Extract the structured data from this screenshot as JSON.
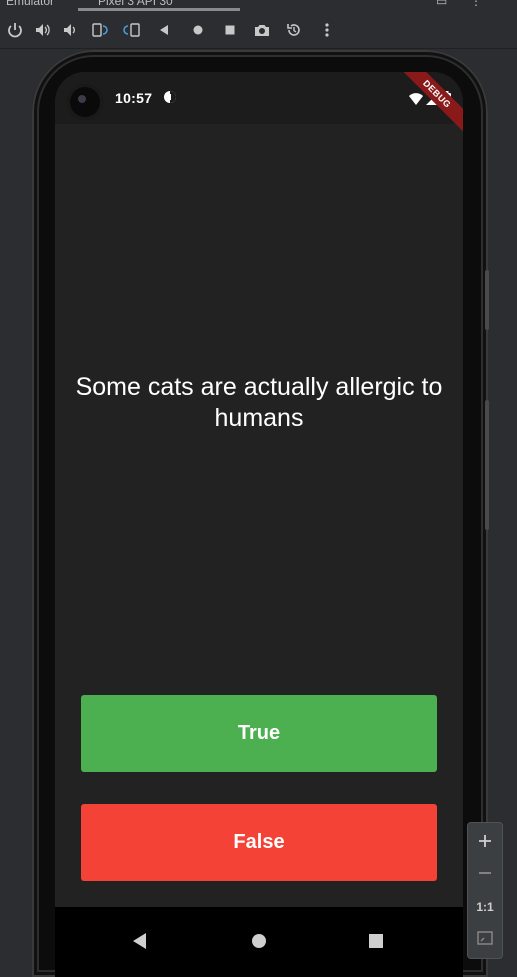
{
  "emulator": {
    "tab_title": "Emulator",
    "device_tab": "Pixel 3 API 30"
  },
  "toolbar": {
    "buttons": [
      "power-icon",
      "volume-up-icon",
      "volume-down-icon",
      "rotate-left-icon",
      "rotate-right-icon",
      "back-icon",
      "home-icon",
      "overview-icon",
      "camera-icon",
      "snapshot-icon",
      "more-icon"
    ]
  },
  "status_bar": {
    "time": "10:57",
    "debug_banner": "DEBUG"
  },
  "quiz": {
    "question": "Some cats are actually allergic to humans",
    "true_label": "True",
    "false_label": "False"
  },
  "colors": {
    "true_button": "#4caf50",
    "false_button": "#f44336",
    "app_background": "#222222"
  },
  "zoom": {
    "reset_label": "1:1"
  }
}
